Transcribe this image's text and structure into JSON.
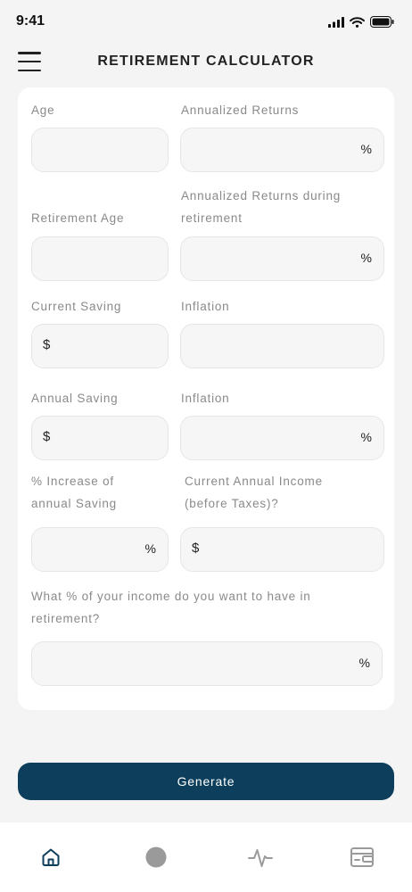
{
  "status_bar": {
    "time": "9:41"
  },
  "header": {
    "title": "RETIREMENT CALCULATOR"
  },
  "form": {
    "age_label": "Age",
    "annualized_returns_label": "Annualized Returns",
    "annualized_returns_suffix": "%",
    "retirement_age_label": "Retirement Age",
    "returns_during_retirement_label_line1": "Annualized Returns during",
    "returns_during_retirement_label_line2": "retirement",
    "returns_during_retirement_suffix": "%",
    "current_saving_label": "Current Saving",
    "current_saving_prefix": "$",
    "inflation_label_1": "Inflation",
    "annual_saving_label": "Annual Saving",
    "annual_saving_prefix": "$",
    "inflation_label_2": "Inflation",
    "inflation_2_suffix": "%",
    "increase_label_line1": "% Increase of",
    "increase_label_line2": "annual Saving",
    "increase_suffix": "%",
    "income_label_line1": "Current Annual Income",
    "income_label_line2": "(before Taxes)?",
    "income_prefix": "$",
    "target_label_line1": "What % of your income do you want to have in",
    "target_label_line2": "retirement?",
    "target_suffix": "%"
  },
  "generate_button": {
    "label": "Generate"
  },
  "bottom_nav": {
    "items": [
      "home-icon",
      "circle-icon",
      "activity-icon",
      "wallet-icon"
    ],
    "active_color": "#0d3f5c",
    "inactive_color": "#9a9a9a"
  },
  "colors": {
    "accent": "#0d3f5c",
    "background": "#f4f4f4",
    "card": "#ffffff"
  }
}
